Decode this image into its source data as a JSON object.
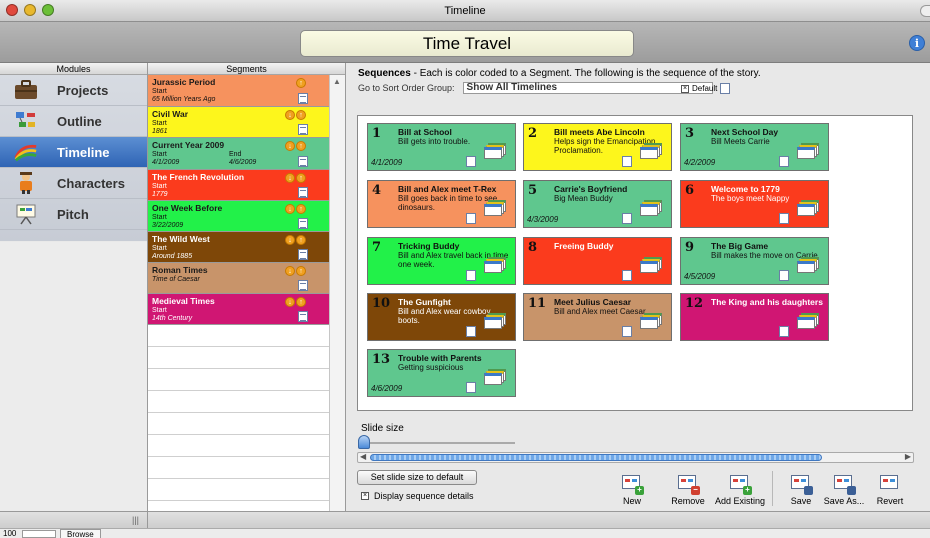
{
  "window": {
    "title": "Timeline"
  },
  "header": {
    "project_title": "Time Travel",
    "info_icon": "info-icon"
  },
  "modules": {
    "heading": "Modules",
    "items": [
      {
        "label": "Projects",
        "icon": "briefcase-icon",
        "active": false
      },
      {
        "label": "Outline",
        "icon": "outline-icon",
        "active": false
      },
      {
        "label": "Timeline",
        "icon": "timeline-icon",
        "active": true
      },
      {
        "label": "Characters",
        "icon": "character-icon",
        "active": false
      },
      {
        "label": "Pitch",
        "icon": "presentation-icon",
        "active": false
      }
    ]
  },
  "segments": {
    "heading": "Segments",
    "items": [
      {
        "title": "Jurassic Period",
        "start_label": "Start",
        "date": "65 Million Years Ago",
        "end_label": "",
        "end_date": "",
        "color": "#f6925e"
      },
      {
        "title": "Civil War",
        "start_label": "Start",
        "date": "1861",
        "end_label": "",
        "end_date": "",
        "color": "#fdf61c"
      },
      {
        "title": "Current Year 2009",
        "start_label": "Start",
        "date": "4/1/2009",
        "end_label": "End",
        "end_date": "4/6/2009",
        "color": "#5fc78e"
      },
      {
        "title": "The French Revolution",
        "start_label": "Start",
        "date": "1779",
        "end_label": "",
        "end_date": "",
        "color": "#fb3b1d"
      },
      {
        "title": "One Week Before",
        "start_label": "Start",
        "date": "3/22/2009",
        "end_label": "",
        "end_date": "",
        "color": "#22f149"
      },
      {
        "title": "The Wild West",
        "start_label": "Start",
        "date": "Around 1885",
        "end_label": "",
        "end_date": "",
        "color": "#7e4708"
      },
      {
        "title": "Roman Times",
        "start_label": "",
        "date": "Time of Caesar",
        "end_label": "",
        "end_date": "",
        "color": "#c8946a"
      },
      {
        "title": "Medieval Times",
        "start_label": "Start",
        "date": "14th Century",
        "end_label": "",
        "end_date": "",
        "color": "#d01673"
      }
    ]
  },
  "sequences": {
    "heading_bold": "Sequences",
    "heading_rest": " - Each is color coded to a Segment. The following is the sequence of the story.",
    "sort_label": "Go to Sort Order Group:",
    "sort_value": "Show All Timelines",
    "default_label": "Default",
    "cards": [
      {
        "num": "1",
        "title": "Bill at School",
        "desc": "Bill gets into trouble.",
        "date": "4/1/2009",
        "color": "#5fc78e"
      },
      {
        "num": "2",
        "title": "Bill meets Abe Lincoln",
        "desc": "Helps sign the Emancipation Proclamation.",
        "date": "",
        "color": "#fdf61c"
      },
      {
        "num": "3",
        "title": "Next School Day",
        "desc": "Bill Meets Carrie",
        "date": "4/2/2009",
        "color": "#5fc78e"
      },
      {
        "num": "4",
        "title": "Bill and Alex meet T-Rex",
        "desc": "Bill goes back in time to see dinosaurs.",
        "date": "",
        "color": "#f6925e"
      },
      {
        "num": "5",
        "title": "Carrie's Boyfriend",
        "desc": "Big Mean Buddy",
        "date": "4/3/2009",
        "color": "#5fc78e"
      },
      {
        "num": "6",
        "title": "Welcome to 1779",
        "desc": "The boys meet Nappy",
        "date": "",
        "color": "#fb3b1d"
      },
      {
        "num": "7",
        "title": "Tricking Buddy",
        "desc": "Bill and Alex travel back in time one week.",
        "date": "",
        "color": "#22f149"
      },
      {
        "num": "8",
        "title": "Freeing Buddy",
        "desc": "",
        "date": "",
        "color": "#fb3b1d"
      },
      {
        "num": "9",
        "title": "The Big Game",
        "desc": "Bill makes the move on Carrie",
        "date": "4/5/2009",
        "color": "#5fc78e"
      },
      {
        "num": "10",
        "title": "The Gunfight",
        "desc": "Bill and Alex wear cowboy boots.",
        "date": "",
        "color": "#7e4708"
      },
      {
        "num": "11",
        "title": "Meet Julius Caesar",
        "desc": "Bill and Alex meet Caesar.",
        "date": "",
        "color": "#c8946a"
      },
      {
        "num": "12",
        "title": "The King and his daughters",
        "desc": "",
        "date": "",
        "color": "#d01673"
      },
      {
        "num": "13",
        "title": "Trouble with Parents",
        "desc": "Getting suspicious",
        "date": "4/6/2009",
        "color": "#5fc78e"
      }
    ]
  },
  "controls": {
    "slide_size_label": "Slide size",
    "set_default_label": "Set slide size to default",
    "display_details_label": "Display sequence details",
    "toolbar": {
      "new": "New",
      "remove": "Remove",
      "add_existing": "Add Existing",
      "save": "Save",
      "save_as": "Save As...",
      "revert": "Revert"
    }
  },
  "statusbar": {
    "zoom": "100",
    "browse": "Browse"
  }
}
